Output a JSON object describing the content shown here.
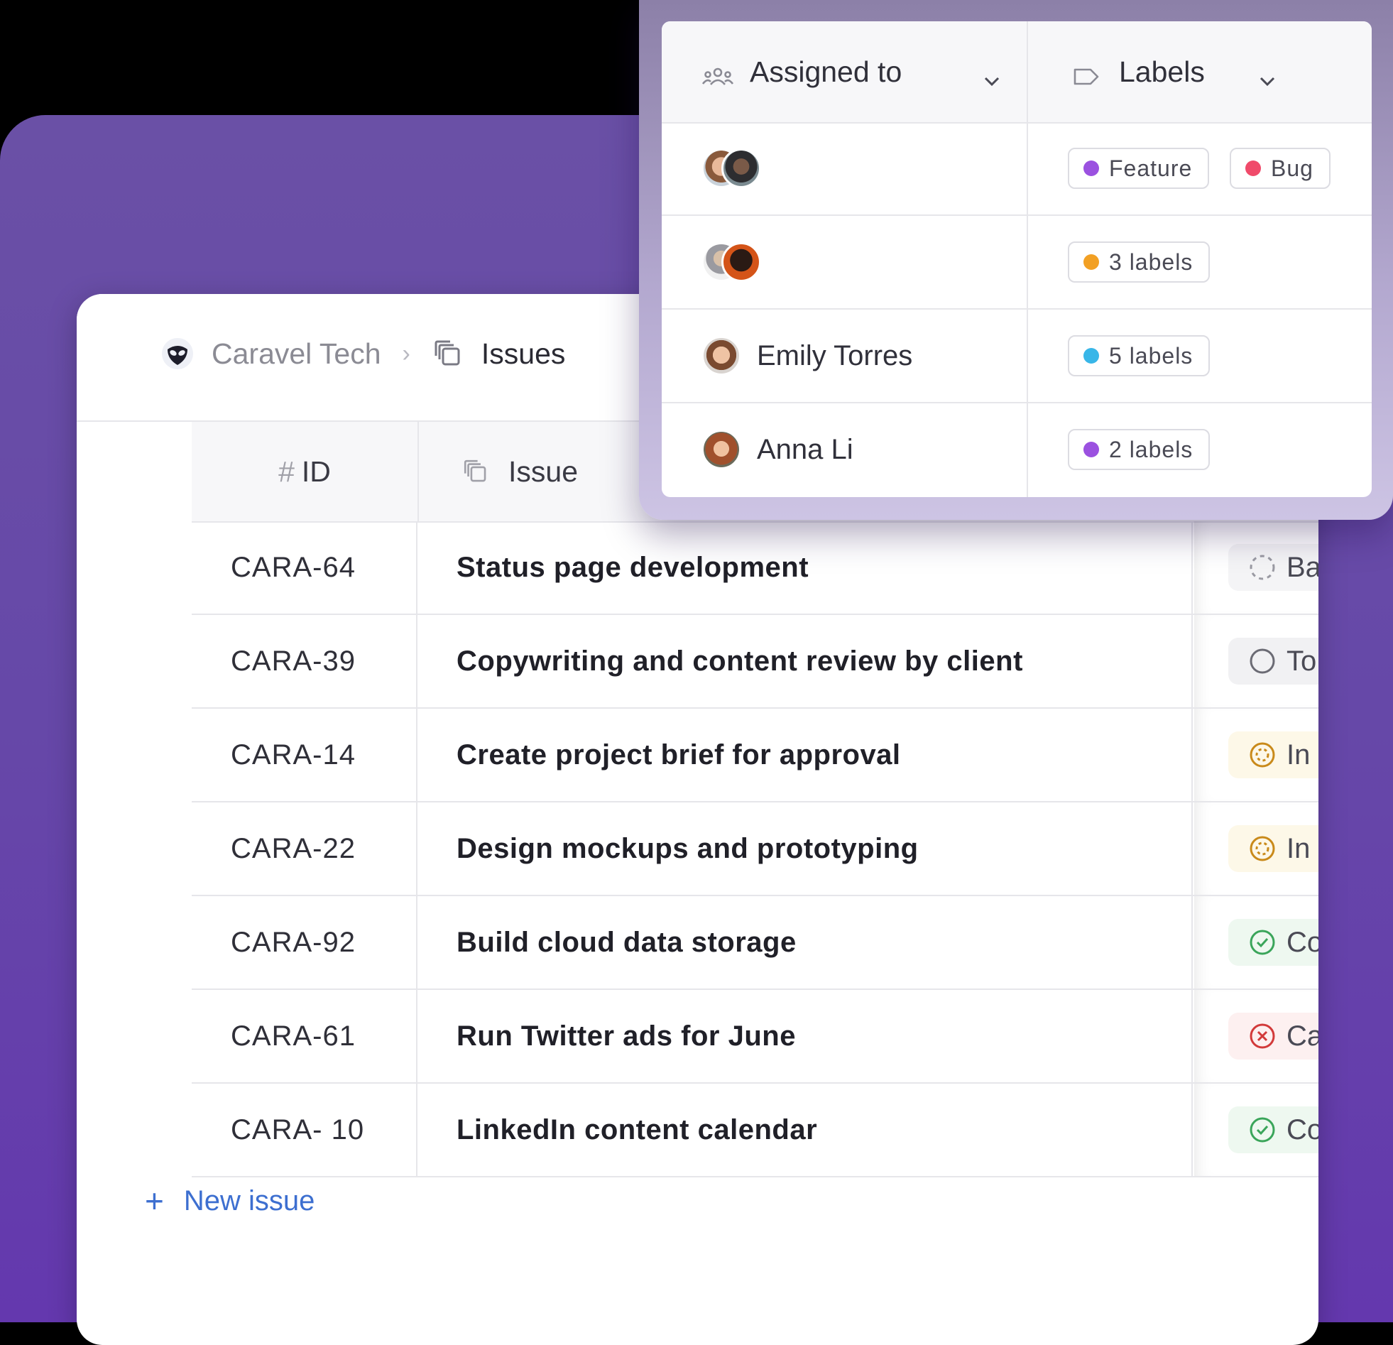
{
  "breadcrumb": {
    "workspace": "Caravel Tech",
    "separator": "›",
    "current": "Issues"
  },
  "table": {
    "headers": {
      "id_hash": "#",
      "id": "ID",
      "issue": "Issue"
    },
    "rows": [
      {
        "id": "CARA-64",
        "title": "Status page development",
        "status": "Ba",
        "status_icon": "backlog-dashed-circle-icon",
        "status_color": "#9a9aa3",
        "status_bg": "#f4f4f6"
      },
      {
        "id": "CARA-39",
        "title": "Copywriting and content review by client",
        "status": "To",
        "status_icon": "todo-circle-icon",
        "status_color": "#6b6b74",
        "status_bg": "#f1f1f3"
      },
      {
        "id": "CARA-14",
        "title": "Create project brief for approval",
        "status": "In",
        "status_icon": "in-progress-circle-icon",
        "status_color": "#c98a1a",
        "status_bg": "#fdf8e8"
      },
      {
        "id": "CARA-22",
        "title": "Design mockups and prototyping",
        "status": "In",
        "status_icon": "in-progress-circle-icon",
        "status_color": "#c98a1a",
        "status_bg": "#fdf8e8"
      },
      {
        "id": "CARA-92",
        "title": "Build cloud data storage",
        "status": "Co",
        "status_icon": "completed-check-circle-icon",
        "status_color": "#3aa55a",
        "status_bg": "#eef8f0"
      },
      {
        "id": "CARA-61",
        "title": "Run Twitter ads for June",
        "status": "Ca",
        "status_icon": "canceled-x-circle-icon",
        "status_color": "#d23a3a",
        "status_bg": "#fdf0f0"
      },
      {
        "id": "CARA- 10",
        "title": "LinkedIn content calendar",
        "status": "Co",
        "status_icon": "completed-check-circle-icon",
        "status_color": "#3aa55a",
        "status_bg": "#eef8f0"
      }
    ]
  },
  "new_issue": {
    "plus": "+",
    "label": "New issue"
  },
  "panel": {
    "assigned_header": "Assigned to",
    "labels_header": "Labels",
    "rows": [
      {
        "assignee_name": "",
        "labels": [
          {
            "text": "Feature",
            "color": "#9b51e0"
          },
          {
            "text": "Bug",
            "color": "#f04a6a"
          }
        ]
      },
      {
        "assignee_name": "",
        "labels": [
          {
            "text": "3 labels",
            "color": "#f2a024"
          }
        ]
      },
      {
        "assignee_name": "Emily Torres",
        "labels": [
          {
            "text": "5 labels",
            "color": "#38b6e8"
          }
        ]
      },
      {
        "assignee_name": "Anna Li",
        "labels": [
          {
            "text": "2 labels",
            "color": "#9b51e0"
          }
        ]
      }
    ]
  },
  "colors": {
    "backdrop": "#6a50a6",
    "link": "#3d6fd0"
  }
}
